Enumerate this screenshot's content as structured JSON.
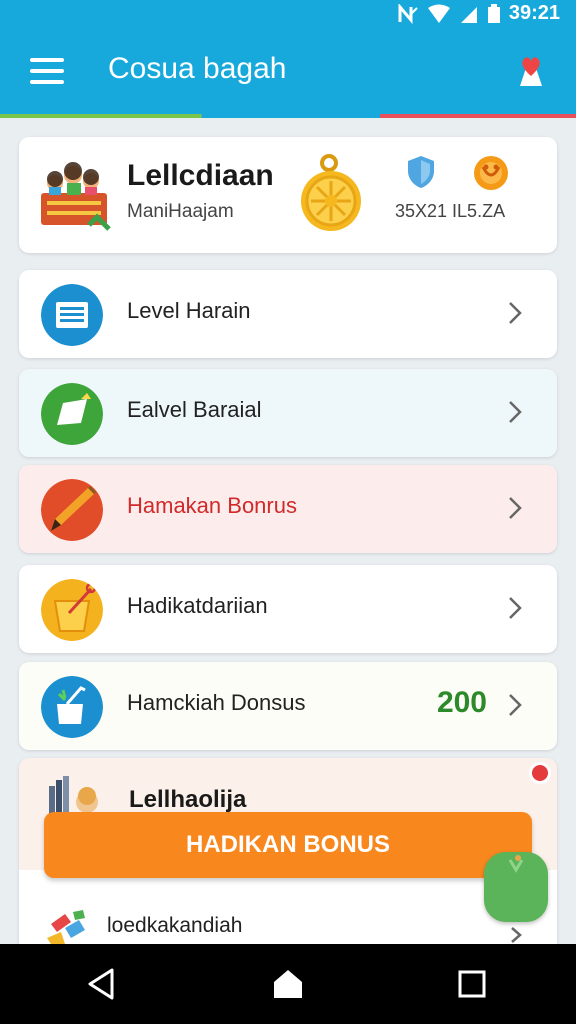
{
  "status_bar": {
    "time": "39:21"
  },
  "app_bar": {
    "title": "Cosua bagah"
  },
  "profile": {
    "name": "Lellcdiaan",
    "subtitle": "ManiHaajam",
    "stats": "35X21 IL5.ZA"
  },
  "menu": [
    {
      "label": "Level Harain",
      "icon": "document-icon",
      "accent": "#1b8fd0"
    },
    {
      "label": "Ealvel Baraial",
      "icon": "note-icon",
      "accent": "#3ea53a"
    },
    {
      "label": "Hamakan Bonrus",
      "icon": "pencil-icon",
      "accent": "#e04d28"
    },
    {
      "label": "Hadikatdariian",
      "icon": "bucket-icon",
      "accent": "#f5b21f"
    },
    {
      "label": "Hamckiah Donsus",
      "icon": "cup-icon",
      "accent": "#1b8fd0",
      "value": "200"
    }
  ],
  "leaderboard": {
    "label": "Lellhaolija"
  },
  "bonus_button": {
    "label": "HADIKAN BONUS"
  },
  "last_item": {
    "label": "loedkakandiah"
  },
  "colors": {
    "primary": "#17a9dc",
    "action": "#f8871e",
    "value": "#2d8a2a",
    "alert": "#d02a2a"
  }
}
